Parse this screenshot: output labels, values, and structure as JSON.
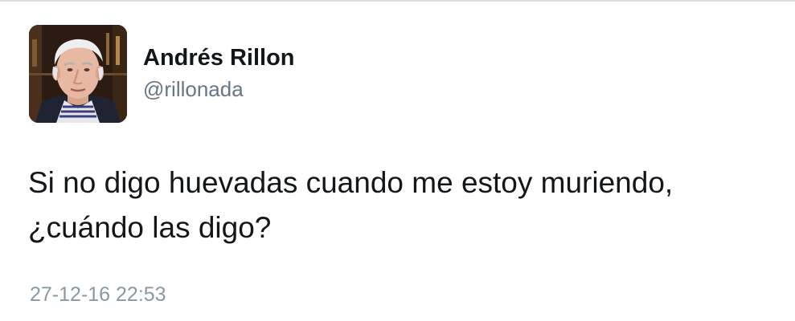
{
  "tweet": {
    "author": {
      "display_name": "Andrés Rillon",
      "handle": "@rillonada",
      "avatar_icon": "profile-photo"
    },
    "text_lines": [
      "Si no digo huevadas cuando me estoy muriendo,",
      "¿cuándo las digo?"
    ],
    "timestamp": "27-12-16 22:53"
  },
  "colors": {
    "name": "#14171a",
    "handle": "#657786",
    "timestamp": "#8899a6",
    "divider": "#d9dde2"
  }
}
